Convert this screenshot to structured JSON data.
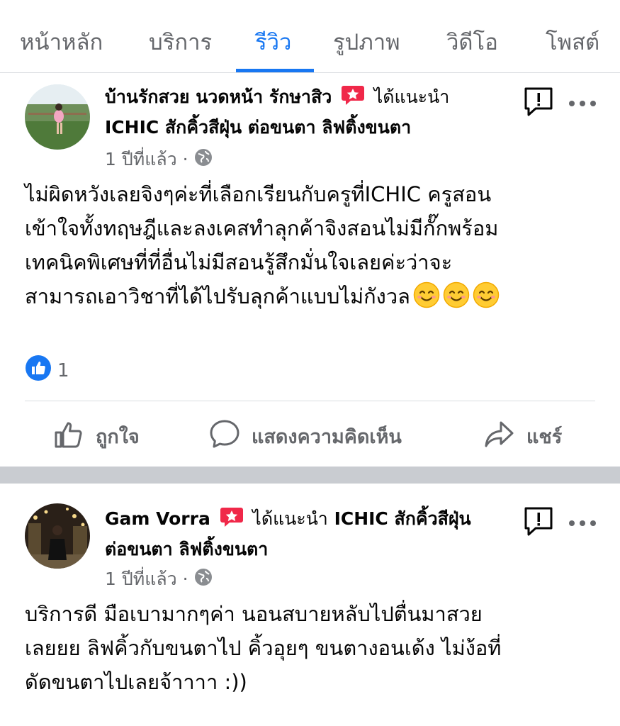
{
  "tabs": [
    {
      "label": "หน้าหลัก",
      "active": false
    },
    {
      "label": "บริการ",
      "active": false
    },
    {
      "label": "รีวิว",
      "active": true
    },
    {
      "label": "รูปภาพ",
      "active": false
    },
    {
      "label": "วิดีโอ",
      "active": false
    },
    {
      "label": "โพสต์",
      "active": false
    }
  ],
  "posts": [
    {
      "author": "บ้านรักสวย นวดหน้า รักษาสิว",
      "recommend_text": "ได้แนะนำ",
      "page_name": "ICHIC สักคิ้วสีฝุ่น ต่อขนตา ลิฟติ้งขนตา",
      "time": "1 ปีที่แล้ว ·",
      "body": [
        "ไม่ผิดหวังเลยจิงๆค่ะที่เลือกเรียนกับครูที่ICHIC ครูสอน",
        "เข้าใจทั้งทฤษฎีและลงเคสทำลุกค้าจิงสอนไม่มีกั๊กพร้อม",
        "เทคนิคพิเศษที่ที่อื่นไม่มีสอนรู้สึกมั่นใจเลยค่ะว่าจะ",
        "สามารถเอาวิชาที่ได้ไปรับลุกค้าแบบไม่กังวล"
      ],
      "like_count": "1",
      "actions": {
        "like": "ถูกใจ",
        "comment": "แสดงความคิดเห็น",
        "share": "แชร์"
      }
    },
    {
      "author": "Gam Vorra",
      "recommend_text": "ได้แนะนำ",
      "page_name_line1": "ICHIC สักคิ้วสีฝุ่น",
      "page_name_line2": "ต่อขนตา ลิฟติ้งขนตา",
      "time": "1 ปีที่แล้ว ·",
      "body": [
        "บริการดี มือเบามากๆค่า นอนสบายหลับไปตื่นมาสวย",
        "เลยยย ลิฟคิ้วกับขนตาไป คิ้วอุยๆ ขนตางอนเด้ง ไม่ง้อที่",
        "ดัดขนตาไปเลยจ้าาาา :))"
      ]
    }
  ],
  "colors": {
    "accent": "#1877f2",
    "recommend": "#f02849",
    "muted": "#65676b"
  }
}
